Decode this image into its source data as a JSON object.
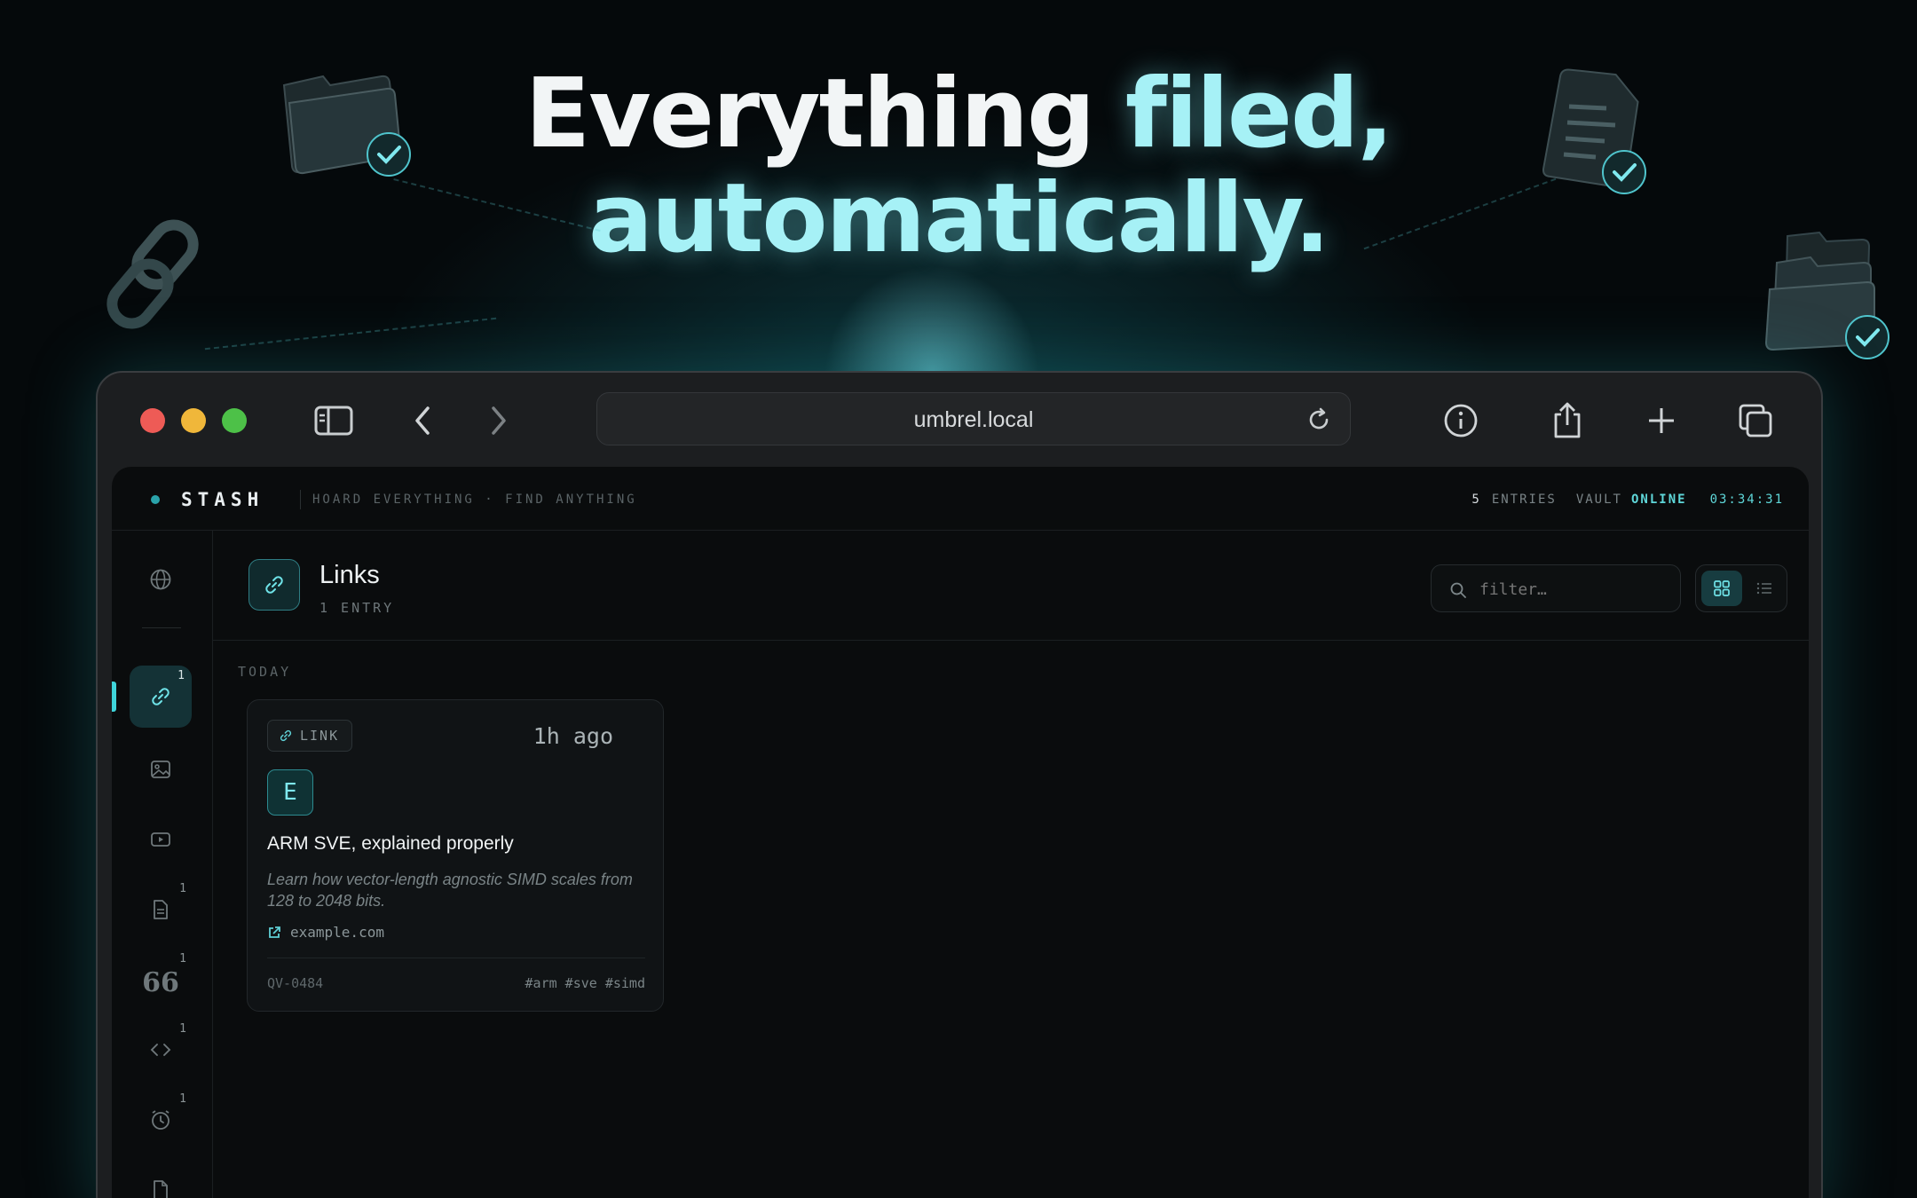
{
  "hero": {
    "line1_white": "Everything ",
    "line1_cyan": "filed,",
    "line2": "automatically."
  },
  "browser": {
    "url": "umbrel.local"
  },
  "app": {
    "brand": "STASH",
    "tagline": "HOARD EVERYTHING · FIND ANYTHING",
    "status": {
      "entries_count": "5",
      "entries_label": "ENTRIES",
      "vault_label": "VAULT",
      "vault_state": "ONLINE",
      "clock": "03:34:31"
    },
    "sidebar": [
      {
        "name": "all",
        "icon": "globe-icon",
        "count": ""
      },
      {
        "name": "links",
        "icon": "link-icon",
        "count": "1",
        "active": true
      },
      {
        "name": "images",
        "icon": "image-icon",
        "count": ""
      },
      {
        "name": "videos",
        "icon": "video-icon",
        "count": ""
      },
      {
        "name": "notes",
        "icon": "document-icon",
        "count": "1"
      },
      {
        "name": "quotes",
        "icon": "quote-icon",
        "count": "1"
      },
      {
        "name": "code",
        "icon": "code-icon",
        "count": "1"
      },
      {
        "name": "reminders",
        "icon": "clock-icon",
        "count": "1"
      },
      {
        "name": "files",
        "icon": "file-icon",
        "count": ""
      }
    ],
    "section": {
      "title": "Links",
      "subtitle": "1 ENTRY",
      "filter_placeholder": "filter…",
      "group_label": "TODAY"
    },
    "card": {
      "type_label": "LINK",
      "time": "1h ago",
      "avatar_letter": "E",
      "title": "ARM SVE, explained properly",
      "description": "Learn how vector-length agnostic SIMD scales from 128 to 2048 bits.",
      "domain": "example.com",
      "id": "QV-0484",
      "tags": "#arm #sve #simd"
    }
  },
  "colors": {
    "accent": "#5fe0e6",
    "hero_cyan": "#a6f1f6",
    "online": "#5fd7d9",
    "background": "#0a0c0d"
  }
}
